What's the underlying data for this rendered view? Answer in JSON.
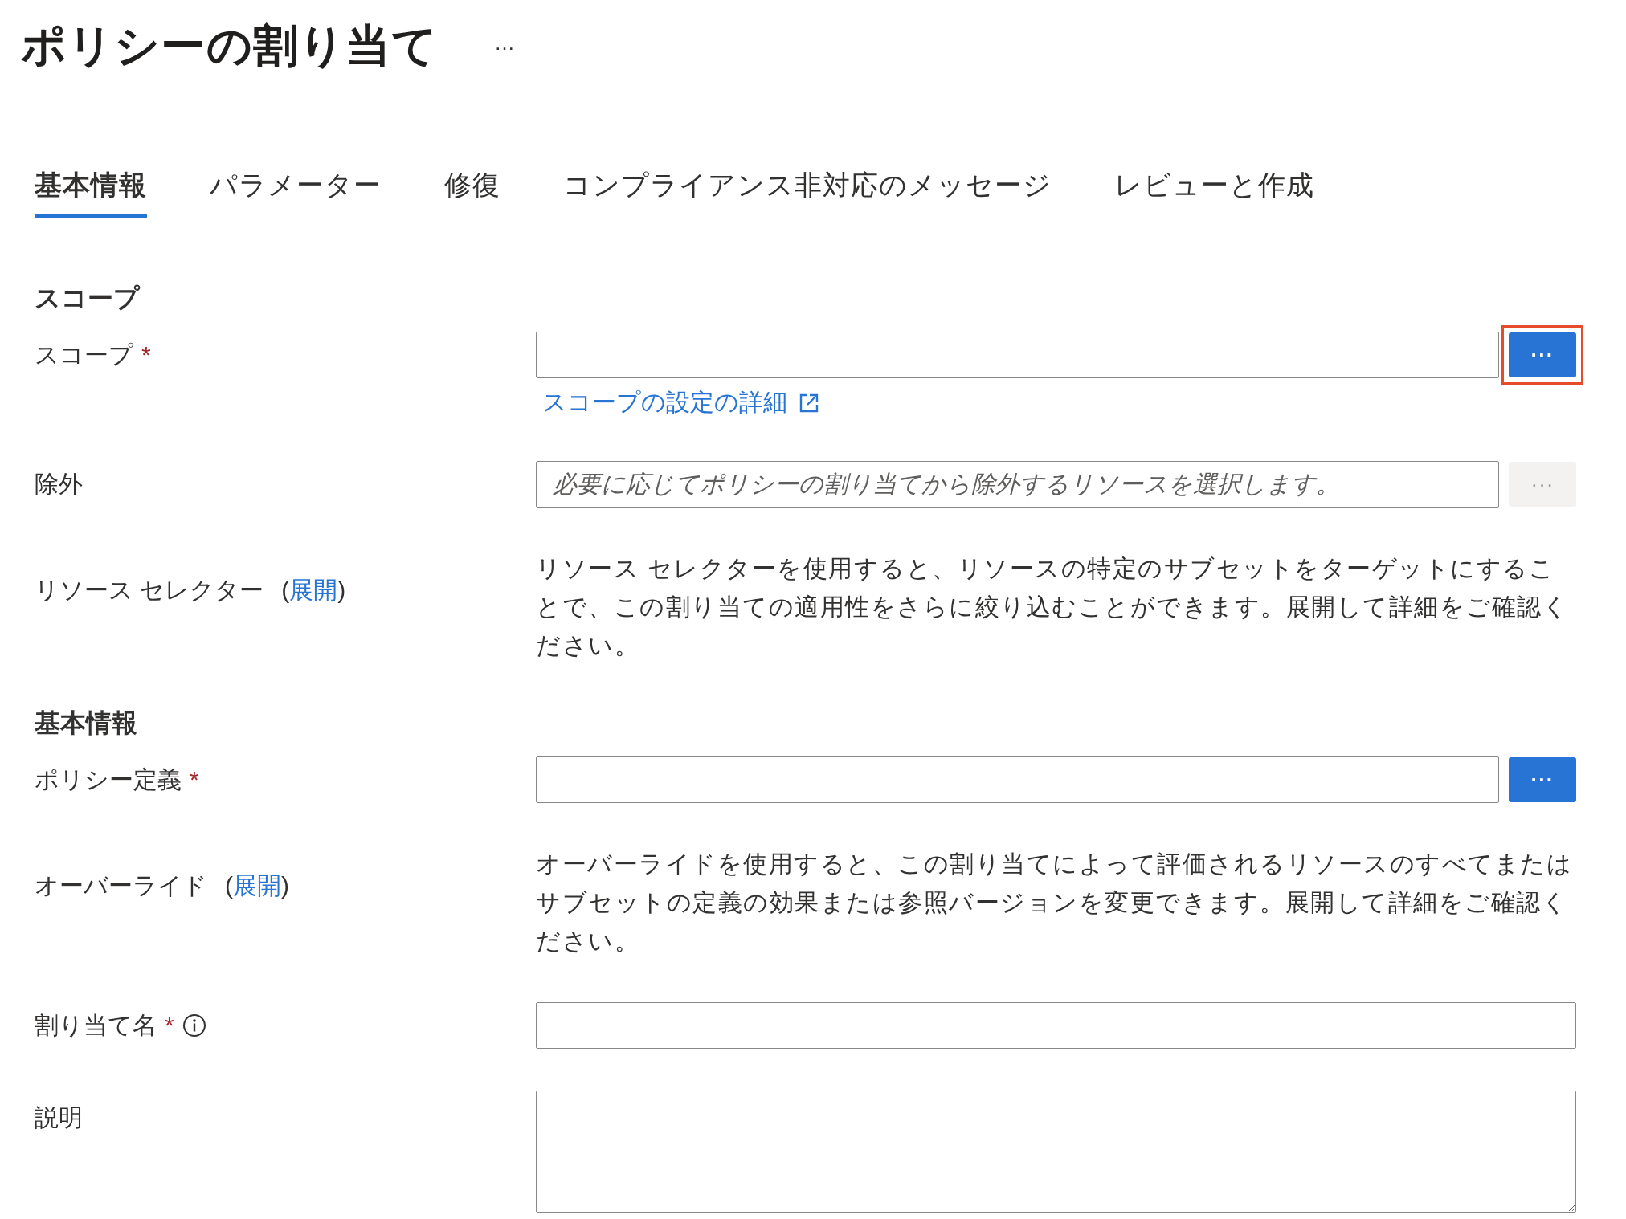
{
  "title": "ポリシーの割り当て",
  "more_button": "…",
  "tabs": [
    {
      "label": "基本情報",
      "selected": true
    },
    {
      "label": "パラメーター",
      "selected": false
    },
    {
      "label": "修復",
      "selected": false
    },
    {
      "label": "コンプライアンス非対応のメッセージ",
      "selected": false
    },
    {
      "label": "レビューと作成",
      "selected": false
    }
  ],
  "sections": [
    {
      "heading": "スコープ",
      "fields": [
        {
          "kind": "picker",
          "label": "スコープ",
          "required_mark": "*",
          "button": {
            "label": "···",
            "disabled": false,
            "highlighted": true
          },
          "link": "スコープの設定の詳細"
        },
        {
          "kind": "picker",
          "label": "除外",
          "placeholder": "必要に応じてポリシーの割り当てから除外するリソースを選択します。",
          "button": {
            "label": "···",
            "disabled": true,
            "highlighted": false
          }
        },
        {
          "kind": "expandable",
          "label": "リソース セレクター",
          "open_paren": "(",
          "expand_link": "展開",
          "close_paren": ")",
          "description": "リソース セレクターを使用すると、リソースの特定のサブセットをターゲットにすることで、この割り当ての適用性をさらに絞り込むことができます。展開して詳細をご確認ください。"
        }
      ]
    },
    {
      "heading": "基本情報",
      "fields": [
        {
          "kind": "picker",
          "label": "ポリシー定義",
          "required_mark": "*",
          "button": {
            "label": "···",
            "disabled": false,
            "highlighted": false
          }
        },
        {
          "kind": "expandable",
          "label": "オーバーライド",
          "open_paren": "(",
          "expand_link": "展開",
          "close_paren": ")",
          "description": "オーバーライドを使用すると、この割り当てによって評価されるリソースのすべてまたはサブセットの定義の効果または参照バージョンを変更できます。展開して詳細をご確認ください。"
        },
        {
          "kind": "text",
          "label": "割り当て名",
          "required_mark": "*",
          "info": true
        },
        {
          "kind": "textarea",
          "label": "説明"
        }
      ]
    }
  ]
}
